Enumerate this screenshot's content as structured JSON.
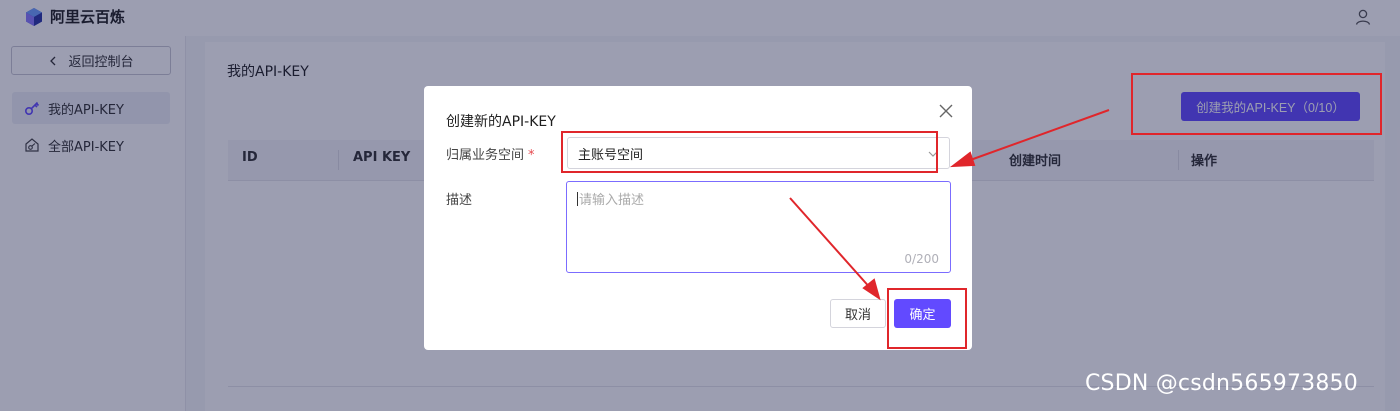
{
  "app": {
    "name": "阿里云百炼"
  },
  "sidebar": {
    "back_label": "返回控制台",
    "items": [
      {
        "label": "我的API-KEY",
        "icon": "key-icon",
        "active": true
      },
      {
        "label": "全部API-KEY",
        "icon": "home-key-icon",
        "active": false
      }
    ]
  },
  "main": {
    "title": "我的API-KEY",
    "create_button": "创建我的API-KEY（0/10）",
    "table": {
      "columns": [
        "ID",
        "API KEY",
        "创建时间",
        "操作"
      ]
    }
  },
  "modal": {
    "title": "创建新的API-KEY",
    "workspace_label": "归属业务空间",
    "required_mark": "*",
    "workspace_value": "主账号空间",
    "description_label": "描述",
    "description_placeholder": "请输入描述",
    "description_counter": "0/200",
    "cancel_label": "取消",
    "confirm_label": "确定"
  },
  "watermark": "CSDN @csdn565973850",
  "colors": {
    "accent": "#624aff",
    "annotation": "#e0262b"
  }
}
